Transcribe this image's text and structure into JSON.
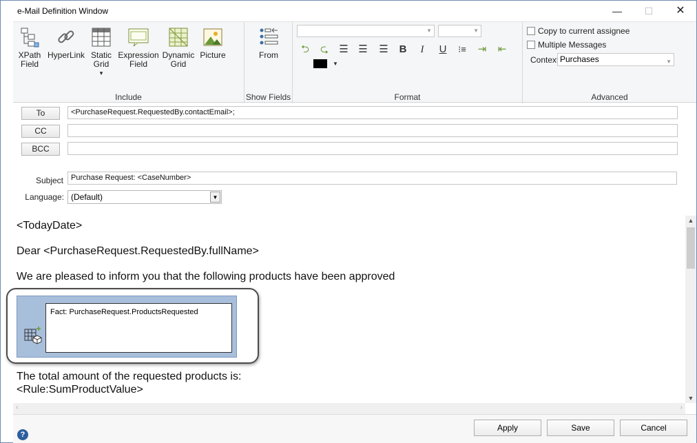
{
  "window": {
    "title": "e-Mail Definition Window",
    "minimize_glyph": "—",
    "maximize_glyph": "☐",
    "close_glyph": "✕"
  },
  "ribbon": {
    "include": {
      "label": "Include",
      "buttons": [
        {
          "label_lines": [
            "XPath",
            "Field"
          ],
          "icon": "xpath-field-icon"
        },
        {
          "label_lines": [
            "HyperLink"
          ],
          "icon": "hyperlink-icon"
        },
        {
          "label_lines": [
            "Static",
            "Grid"
          ],
          "icon": "static-grid-icon",
          "dropdown": "▾"
        },
        {
          "label_lines": [
            "Expression",
            "Field"
          ],
          "icon": "expression-field-icon"
        },
        {
          "label_lines": [
            "Dynamic",
            "Grid"
          ],
          "icon": "dynamic-grid-icon"
        },
        {
          "label_lines": [
            "Picture"
          ],
          "icon": "picture-icon"
        }
      ]
    },
    "show_fields": {
      "label": "Show Fields",
      "button": {
        "label": "From",
        "icon": "from-fields-icon"
      }
    },
    "format": {
      "label": "Format",
      "font_name": "",
      "font_size": "",
      "icons": [
        "undo-icon",
        "redo-icon",
        "align-left-icon",
        "align-center-icon",
        "align-right-icon",
        "bold-icon",
        "italic-icon",
        "underline-icon",
        "bullet-list-icon",
        "indent-icon",
        "outdent-icon"
      ],
      "glyphs": {
        "bold": "B",
        "italic": "I",
        "underline": "U"
      },
      "font_color": "#000000"
    },
    "advanced": {
      "label": "Advanced",
      "copy_to_assignee": "Copy to current assignee",
      "multiple_messages": "Multiple Messages",
      "context_label": "Context",
      "context_value": "Purchases"
    }
  },
  "header": {
    "to_label": "To",
    "to_value": "<PurchaseRequest.RequestedBy.contactEmail>;",
    "cc_label": "CC",
    "cc_value": "",
    "bcc_label": "BCC",
    "bcc_value": "",
    "subject_label": "Subject",
    "subject_value": "Purchase Request: <CaseNumber>",
    "language_label": "Language:",
    "language_value": "(Default)"
  },
  "body": {
    "line1": "<TodayDate>",
    "line2": "Dear <PurchaseRequest.RequestedBy.fullName>",
    "line3": "We are pleased to inform you that the following products have been approved",
    "fact_label": "Fact: PurchaseRequest.ProductsRequested",
    "line4": "The total amount of the requested products is:",
    "line5": "<Rule:SumProductValue>"
  },
  "footer": {
    "apply": "Apply",
    "save": "Save",
    "cancel": "Cancel",
    "help": "?"
  }
}
